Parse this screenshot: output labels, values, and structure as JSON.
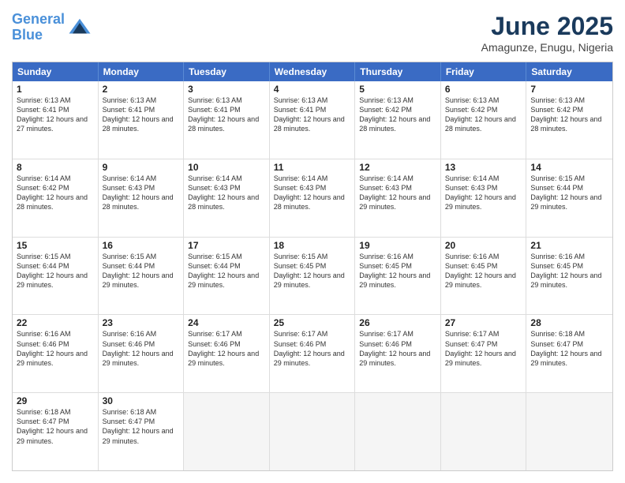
{
  "logo": {
    "line1": "General",
    "line2": "Blue"
  },
  "title": "June 2025",
  "location": "Amagunze, Enugu, Nigeria",
  "header": {
    "days": [
      "Sunday",
      "Monday",
      "Tuesday",
      "Wednesday",
      "Thursday",
      "Friday",
      "Saturday"
    ]
  },
  "rows": [
    [
      {
        "day": "1",
        "sunrise": "6:13 AM",
        "sunset": "6:41 PM",
        "daylight": "12 hours and 27 minutes."
      },
      {
        "day": "2",
        "sunrise": "6:13 AM",
        "sunset": "6:41 PM",
        "daylight": "12 hours and 28 minutes."
      },
      {
        "day": "3",
        "sunrise": "6:13 AM",
        "sunset": "6:41 PM",
        "daylight": "12 hours and 28 minutes."
      },
      {
        "day": "4",
        "sunrise": "6:13 AM",
        "sunset": "6:41 PM",
        "daylight": "12 hours and 28 minutes."
      },
      {
        "day": "5",
        "sunrise": "6:13 AM",
        "sunset": "6:42 PM",
        "daylight": "12 hours and 28 minutes."
      },
      {
        "day": "6",
        "sunrise": "6:13 AM",
        "sunset": "6:42 PM",
        "daylight": "12 hours and 28 minutes."
      },
      {
        "day": "7",
        "sunrise": "6:13 AM",
        "sunset": "6:42 PM",
        "daylight": "12 hours and 28 minutes."
      }
    ],
    [
      {
        "day": "8",
        "sunrise": "6:14 AM",
        "sunset": "6:42 PM",
        "daylight": "12 hours and 28 minutes."
      },
      {
        "day": "9",
        "sunrise": "6:14 AM",
        "sunset": "6:43 PM",
        "daylight": "12 hours and 28 minutes."
      },
      {
        "day": "10",
        "sunrise": "6:14 AM",
        "sunset": "6:43 PM",
        "daylight": "12 hours and 28 minutes."
      },
      {
        "day": "11",
        "sunrise": "6:14 AM",
        "sunset": "6:43 PM",
        "daylight": "12 hours and 28 minutes."
      },
      {
        "day": "12",
        "sunrise": "6:14 AM",
        "sunset": "6:43 PM",
        "daylight": "12 hours and 29 minutes."
      },
      {
        "day": "13",
        "sunrise": "6:14 AM",
        "sunset": "6:43 PM",
        "daylight": "12 hours and 29 minutes."
      },
      {
        "day": "14",
        "sunrise": "6:15 AM",
        "sunset": "6:44 PM",
        "daylight": "12 hours and 29 minutes."
      }
    ],
    [
      {
        "day": "15",
        "sunrise": "6:15 AM",
        "sunset": "6:44 PM",
        "daylight": "12 hours and 29 minutes."
      },
      {
        "day": "16",
        "sunrise": "6:15 AM",
        "sunset": "6:44 PM",
        "daylight": "12 hours and 29 minutes."
      },
      {
        "day": "17",
        "sunrise": "6:15 AM",
        "sunset": "6:44 PM",
        "daylight": "12 hours and 29 minutes."
      },
      {
        "day": "18",
        "sunrise": "6:15 AM",
        "sunset": "6:45 PM",
        "daylight": "12 hours and 29 minutes."
      },
      {
        "day": "19",
        "sunrise": "6:16 AM",
        "sunset": "6:45 PM",
        "daylight": "12 hours and 29 minutes."
      },
      {
        "day": "20",
        "sunrise": "6:16 AM",
        "sunset": "6:45 PM",
        "daylight": "12 hours and 29 minutes."
      },
      {
        "day": "21",
        "sunrise": "6:16 AM",
        "sunset": "6:45 PM",
        "daylight": "12 hours and 29 minutes."
      }
    ],
    [
      {
        "day": "22",
        "sunrise": "6:16 AM",
        "sunset": "6:46 PM",
        "daylight": "12 hours and 29 minutes."
      },
      {
        "day": "23",
        "sunrise": "6:16 AM",
        "sunset": "6:46 PM",
        "daylight": "12 hours and 29 minutes."
      },
      {
        "day": "24",
        "sunrise": "6:17 AM",
        "sunset": "6:46 PM",
        "daylight": "12 hours and 29 minutes."
      },
      {
        "day": "25",
        "sunrise": "6:17 AM",
        "sunset": "6:46 PM",
        "daylight": "12 hours and 29 minutes."
      },
      {
        "day": "26",
        "sunrise": "6:17 AM",
        "sunset": "6:46 PM",
        "daylight": "12 hours and 29 minutes."
      },
      {
        "day": "27",
        "sunrise": "6:17 AM",
        "sunset": "6:47 PM",
        "daylight": "12 hours and 29 minutes."
      },
      {
        "day": "28",
        "sunrise": "6:18 AM",
        "sunset": "6:47 PM",
        "daylight": "12 hours and 29 minutes."
      }
    ],
    [
      {
        "day": "29",
        "sunrise": "6:18 AM",
        "sunset": "6:47 PM",
        "daylight": "12 hours and 29 minutes."
      },
      {
        "day": "30",
        "sunrise": "6:18 AM",
        "sunset": "6:47 PM",
        "daylight": "12 hours and 29 minutes."
      },
      {
        "day": "",
        "sunrise": "",
        "sunset": "",
        "daylight": ""
      },
      {
        "day": "",
        "sunrise": "",
        "sunset": "",
        "daylight": ""
      },
      {
        "day": "",
        "sunrise": "",
        "sunset": "",
        "daylight": ""
      },
      {
        "day": "",
        "sunrise": "",
        "sunset": "",
        "daylight": ""
      },
      {
        "day": "",
        "sunrise": "",
        "sunset": "",
        "daylight": ""
      }
    ]
  ]
}
